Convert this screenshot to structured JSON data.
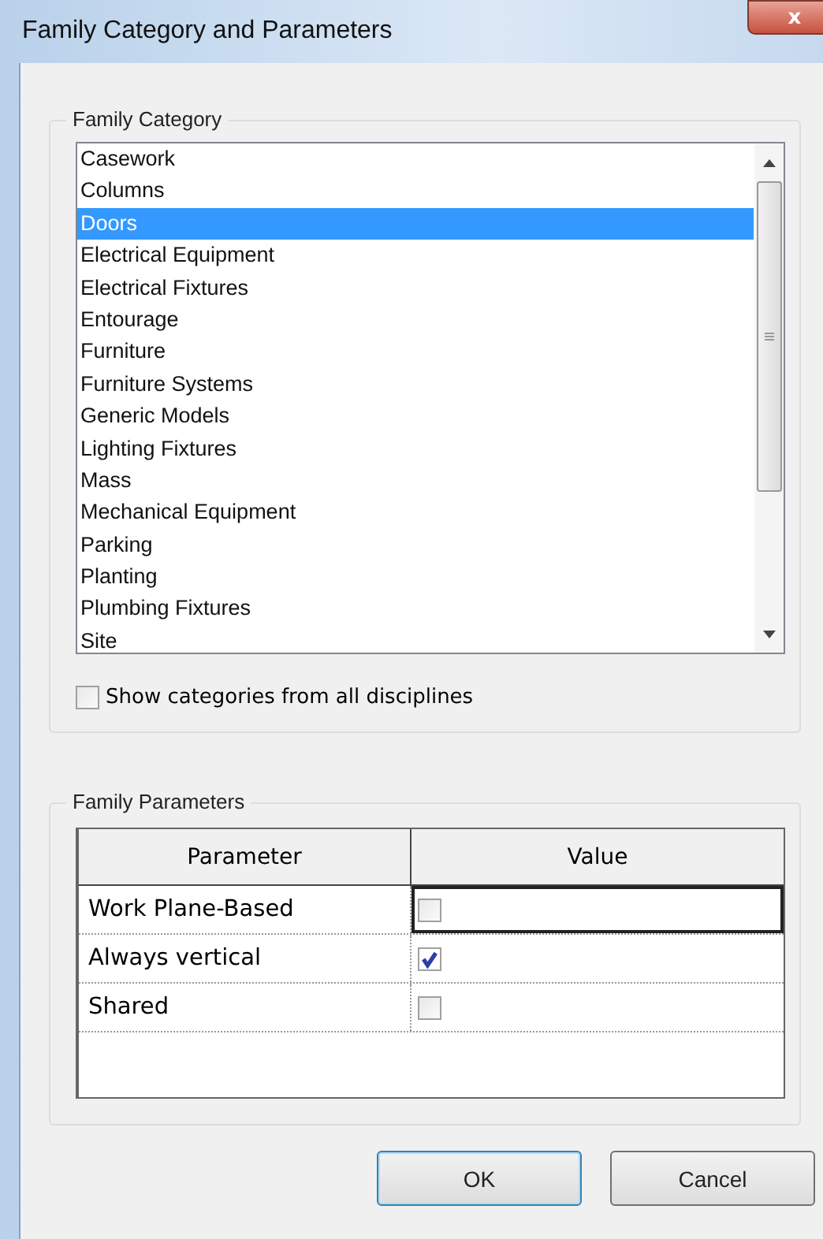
{
  "window": {
    "title": "Family Category and Parameters",
    "close": "x"
  },
  "family_category": {
    "legend": "Family Category",
    "items": [
      {
        "label": "Casework",
        "selected": false
      },
      {
        "label": "Columns",
        "selected": false
      },
      {
        "label": "Doors",
        "selected": true
      },
      {
        "label": "Electrical Equipment",
        "selected": false
      },
      {
        "label": "Electrical Fixtures",
        "selected": false
      },
      {
        "label": "Entourage",
        "selected": false
      },
      {
        "label": "Furniture",
        "selected": false
      },
      {
        "label": "Furniture Systems",
        "selected": false
      },
      {
        "label": "Generic Models",
        "selected": false
      },
      {
        "label": "Lighting Fixtures",
        "selected": false
      },
      {
        "label": "Mass",
        "selected": false
      },
      {
        "label": "Mechanical Equipment",
        "selected": false
      },
      {
        "label": "Parking",
        "selected": false
      },
      {
        "label": "Planting",
        "selected": false
      },
      {
        "label": "Plumbing Fixtures",
        "selected": false
      },
      {
        "label": "Site",
        "selected": false
      }
    ],
    "show_all": {
      "label": "Show categories from all disciplines",
      "checked": false
    }
  },
  "family_parameters": {
    "legend": "Family Parameters",
    "columns": [
      "Parameter",
      "Value"
    ],
    "rows": [
      {
        "name": "Work Plane-Based",
        "checked": false,
        "selected": true
      },
      {
        "name": "Always vertical",
        "checked": true,
        "selected": false
      },
      {
        "name": "Shared",
        "checked": false,
        "selected": false
      }
    ]
  },
  "buttons": [
    {
      "label": "OK",
      "default": true
    },
    {
      "label": "Cancel",
      "default": false
    }
  ]
}
